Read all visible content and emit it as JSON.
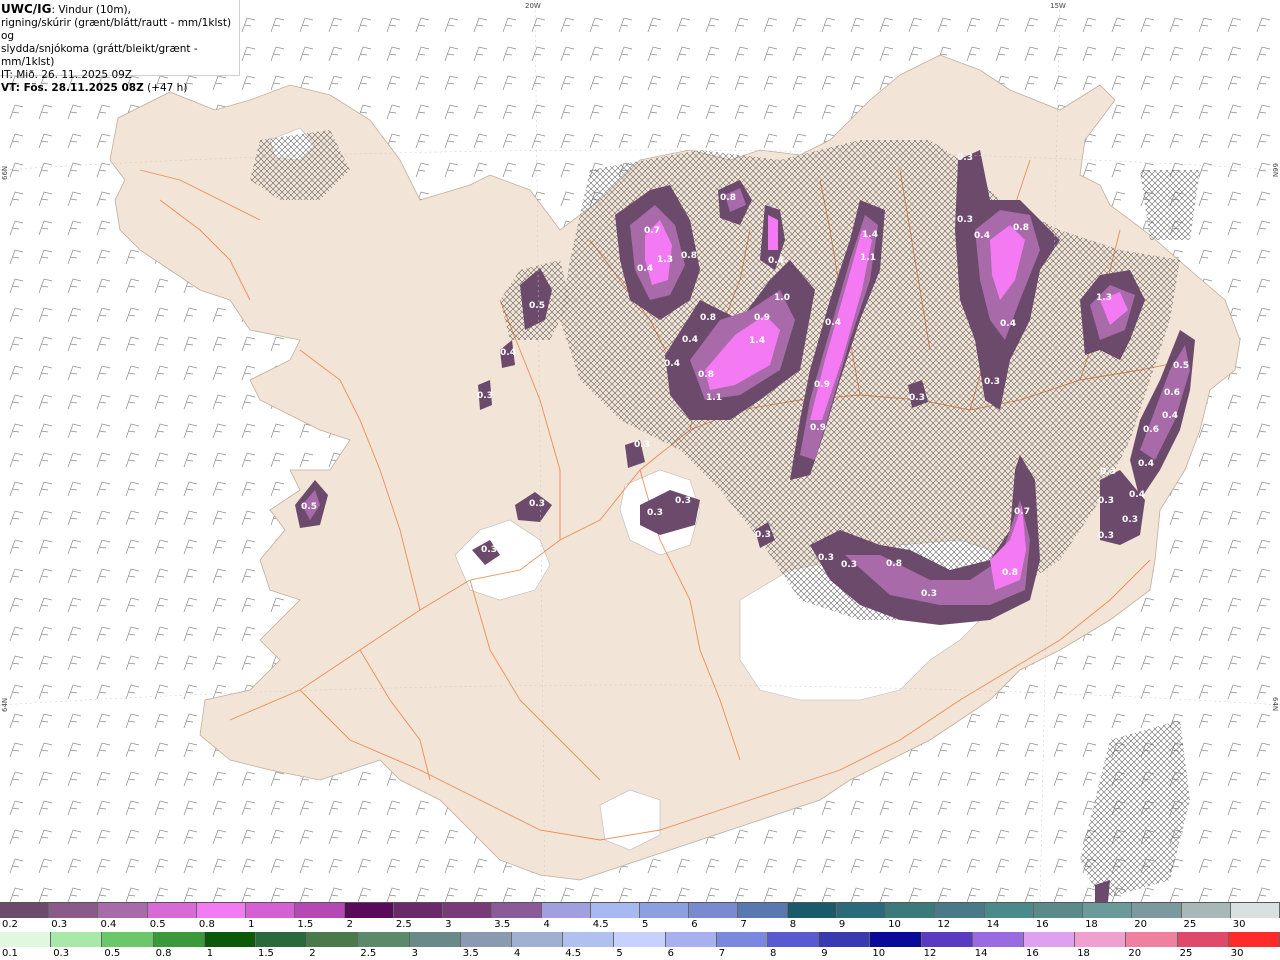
{
  "header": {
    "product": "UWC/IG",
    "desc_line1": ": Vindur (10m),",
    "desc_line2": "rigning/skúrir (grænt/blátt/rautt - mm/1klst) og",
    "desc_line3": "slydda/snjókoma (grátt/bleikt/grænt - mm/1klst)",
    "issue_time": "IT: Mið. 26. 11. 2025 09Z",
    "valid_time": "VT: Fös. 28.11.2025 08Z",
    "lead": "(+47 h)"
  },
  "grid_labels": {
    "lon_20w": "20W",
    "lon_15w": "15W",
    "lat_66n_left": "66N",
    "lat_66n_right": "66N",
    "lat_64n_left": "64N",
    "lat_64n_right": "64N"
  },
  "map_labels": [
    {
      "text": "0.7"
    },
    {
      "text": "1.3"
    },
    {
      "text": "0.8"
    },
    {
      "text": "0.4"
    },
    {
      "text": "0.8"
    },
    {
      "text": "0.5"
    },
    {
      "text": "0.4"
    },
    {
      "text": "0.3"
    },
    {
      "text": "0.8"
    },
    {
      "text": "0.4"
    },
    {
      "text": "0.4"
    },
    {
      "text": "1.0"
    },
    {
      "text": "0.9"
    },
    {
      "text": "1.4"
    },
    {
      "text": "0.4"
    },
    {
      "text": "0.8"
    },
    {
      "text": "1.1"
    },
    {
      "text": "1.4"
    },
    {
      "text": "1.1"
    },
    {
      "text": "0.4"
    },
    {
      "text": "0.9"
    },
    {
      "text": "0.9"
    },
    {
      "text": "0.3"
    },
    {
      "text": "0.3"
    },
    {
      "text": "0.4"
    },
    {
      "text": "0.8"
    },
    {
      "text": "0.4"
    },
    {
      "text": "0.3"
    },
    {
      "text": "0.3"
    },
    {
      "text": "1.3"
    },
    {
      "text": "0.5"
    },
    {
      "text": "0.6"
    },
    {
      "text": "0.4"
    },
    {
      "text": "0.6"
    },
    {
      "text": "0.4"
    },
    {
      "text": "0.3"
    },
    {
      "text": "0.4"
    },
    {
      "text": "0.3"
    },
    {
      "text": "0.3"
    },
    {
      "text": "0.3"
    },
    {
      "text": "0.5"
    },
    {
      "text": "0.3"
    },
    {
      "text": "0.3"
    },
    {
      "text": "0.3"
    },
    {
      "text": "0.3"
    },
    {
      "text": "0.3"
    },
    {
      "text": "0.3"
    },
    {
      "text": "0.3"
    },
    {
      "text": "0.8"
    },
    {
      "text": "0.3"
    },
    {
      "text": "0.8"
    },
    {
      "text": "0.7"
    },
    {
      "text": "0.3"
    }
  ],
  "legend": {
    "snow_labels": [
      "0.2",
      "0.3",
      "0.4",
      "0.5",
      "0.8",
      "1",
      "1.5",
      "2",
      "2.5",
      "3",
      "3.5",
      "4",
      "4.5",
      "5",
      "6",
      "7",
      "8",
      "9",
      "10",
      "12",
      "14",
      "16",
      "18",
      "20",
      "25",
      "30"
    ],
    "snow_colors": [
      "#6c4a6c",
      "#8a5a8a",
      "#a86aa8",
      "#d86ad8",
      "#f47af4",
      "#d460d4",
      "#b448b4",
      "#5a0a5a",
      "#6a2a6a",
      "#7a3a7a",
      "#8a5a9a",
      "#a0a0e0",
      "#a8b8f0",
      "#8aa0e0",
      "#7a8ad0",
      "#5a78b0",
      "#1a5a6a",
      "#2a6a7a",
      "#3a7a7a",
      "#4a7a8a",
      "#4a8a8a",
      "#5a8a8a",
      "#6a9a9a",
      "#7a9aa0",
      "#a8b8b8",
      "#d8e0e0"
    ],
    "rain_labels": [
      "0.1",
      "0.3",
      "0.5",
      "0.8",
      "1",
      "1.5",
      "2",
      "2.5",
      "3",
      "3.5",
      "4",
      "4.5",
      "5",
      "6",
      "7",
      "8",
      "9",
      "10",
      "12",
      "14",
      "16",
      "18",
      "20",
      "25",
      "30"
    ],
    "rain_colors": [
      "#e0f8e0",
      "#a8e8a8",
      "#6ac86a",
      "#3a9a3a",
      "#0a5a0a",
      "#2a6a3a",
      "#4a7a4a",
      "#5a8a6a",
      "#6a8a8a",
      "#8a9ab0",
      "#a0b0d0",
      "#b0c0f0",
      "#c8d0ff",
      "#a8b0f0",
      "#7a88e0",
      "#5a5ad0",
      "#3a3ab0",
      "#0a0a9a",
      "#5a3ac0",
      "#9a6ae0",
      "#e0a0f0",
      "#f0a0d0",
      "#f080a0",
      "#e04a6a",
      "#ff2a2a"
    ]
  },
  "colors": {
    "land": "#f2e4d6",
    "ice": "#ffffff",
    "road": "#e8702a",
    "sea": "#ffffff",
    "wind_barb": "#8c8c8c",
    "precip_light": "#6c4a6c",
    "precip_mid": "#a86aa8",
    "precip_heavy": "#f47af4"
  }
}
